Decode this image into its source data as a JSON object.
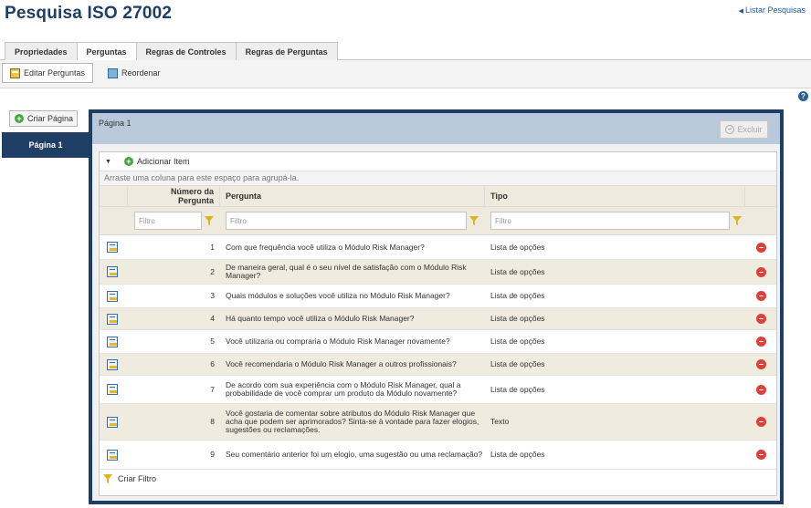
{
  "page_title": "Pesquisa ISO 27002",
  "back_link": "Listar Pesquisas",
  "tabs": [
    {
      "label": "Propriedades",
      "active": false
    },
    {
      "label": "Perguntas",
      "active": true
    },
    {
      "label": "Regras de Controles",
      "active": false
    },
    {
      "label": "Regras de Perguntas",
      "active": false
    }
  ],
  "toolbar": {
    "edit_label": "Editar Perguntas",
    "reorder_label": "Reordenar"
  },
  "sidebar": {
    "create_page": "Criar Página",
    "pages": [
      "Página 1"
    ]
  },
  "panel": {
    "title": "Página 1",
    "delete_label": "Excluir",
    "add_item": "Adicionar Item",
    "group_hint": "Arraste uma coluna para este espaço para agrupá-la.",
    "columns": {
      "number": "Número da Pergunta",
      "question": "Pergunta",
      "type": "Tipo"
    },
    "filter_placeholder": "Filtro",
    "create_filter": "Criar Filtro",
    "rows": [
      {
        "number": "1",
        "question": "Com que frequência você utiliza o Módulo Risk Manager?",
        "type": "Lista de opções"
      },
      {
        "number": "2",
        "question": "De maneira geral, qual é o seu nível de satisfação com o Módulo Risk Manager?",
        "type": "Lista de opções"
      },
      {
        "number": "3",
        "question": "Quais módulos e soluções você utiliza no Módulo Risk Manager?",
        "type": "Lista de opções"
      },
      {
        "number": "4",
        "question": "Há quanto tempo você utiliza o Módulo Risk Manager?",
        "type": "Lista de opções"
      },
      {
        "number": "5",
        "question": "Você utilizaria ou compraria o Módulo Risk Manager novamente?",
        "type": "Lista de opções"
      },
      {
        "number": "6",
        "question": "Você recomendaria o Módulo Risk Manager a outros profissionais?",
        "type": "Lista de opções"
      },
      {
        "number": "7",
        "question": "De acordo com sua experiência com o Módulo Risk Manager, qual a probabilidade de você comprar um produto da Módulo novamente?",
        "type": "Lista de opções"
      },
      {
        "number": "8",
        "question": "Você gostaria de comentar sobre atributos do Módulo Risk Manager que acha que podem ser aprimorados? Sinta-se à vontade para fazer elogios, sugestões ou reclamações.",
        "type": "Texto"
      },
      {
        "number": "9",
        "question": "Seu comentário anterior foi um elogio, uma sugestão ou uma reclamação?",
        "type": "Lista de opções"
      }
    ]
  },
  "colors": {
    "navy": "#1f3e66",
    "panel_header": "#b9c9d9",
    "alt_row": "#efebdf",
    "delete_red": "#d9423b",
    "add_green": "#4aa544"
  }
}
